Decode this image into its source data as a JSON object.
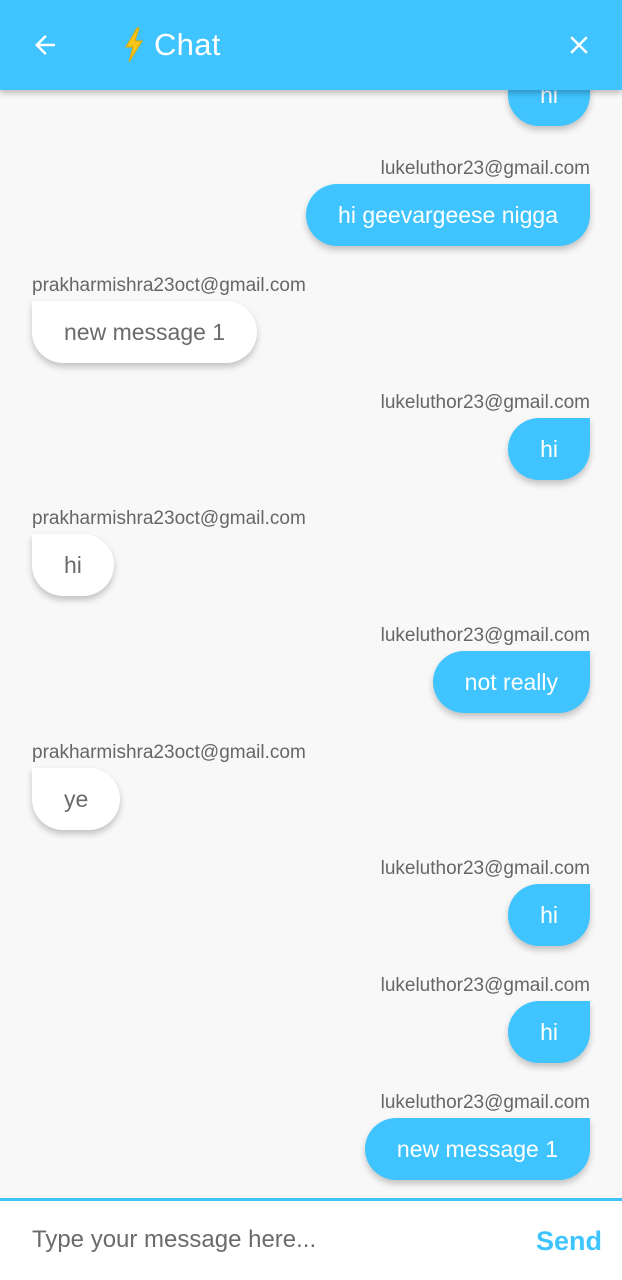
{
  "appbar": {
    "title": "Chat",
    "color": "#40c4ff",
    "back_icon": "arrow-back-icon",
    "title_icon": "lightning-bolt-icon",
    "close_icon": "close-icon"
  },
  "messages": [
    {
      "sender": "",
      "text": "hi",
      "is_me": true
    },
    {
      "sender": "lukeluthor23@gmail.com",
      "text": "hi geevargeese nigga",
      "is_me": true
    },
    {
      "sender": "prakharmishra23oct@gmail.com",
      "text": "new message 1",
      "is_me": false
    },
    {
      "sender": "lukeluthor23@gmail.com",
      "text": "hi",
      "is_me": true
    },
    {
      "sender": "prakharmishra23oct@gmail.com",
      "text": "hi",
      "is_me": false
    },
    {
      "sender": "lukeluthor23@gmail.com",
      "text": "not really",
      "is_me": true
    },
    {
      "sender": "prakharmishra23oct@gmail.com",
      "text": "ye",
      "is_me": false
    },
    {
      "sender": "lukeluthor23@gmail.com",
      "text": "hi",
      "is_me": true
    },
    {
      "sender": "lukeluthor23@gmail.com",
      "text": "hi",
      "is_me": true
    },
    {
      "sender": "lukeluthor23@gmail.com",
      "text": "new message 1",
      "is_me": true
    }
  ],
  "composer": {
    "placeholder": "Type your message here...",
    "value": "",
    "send_label": "Send"
  }
}
